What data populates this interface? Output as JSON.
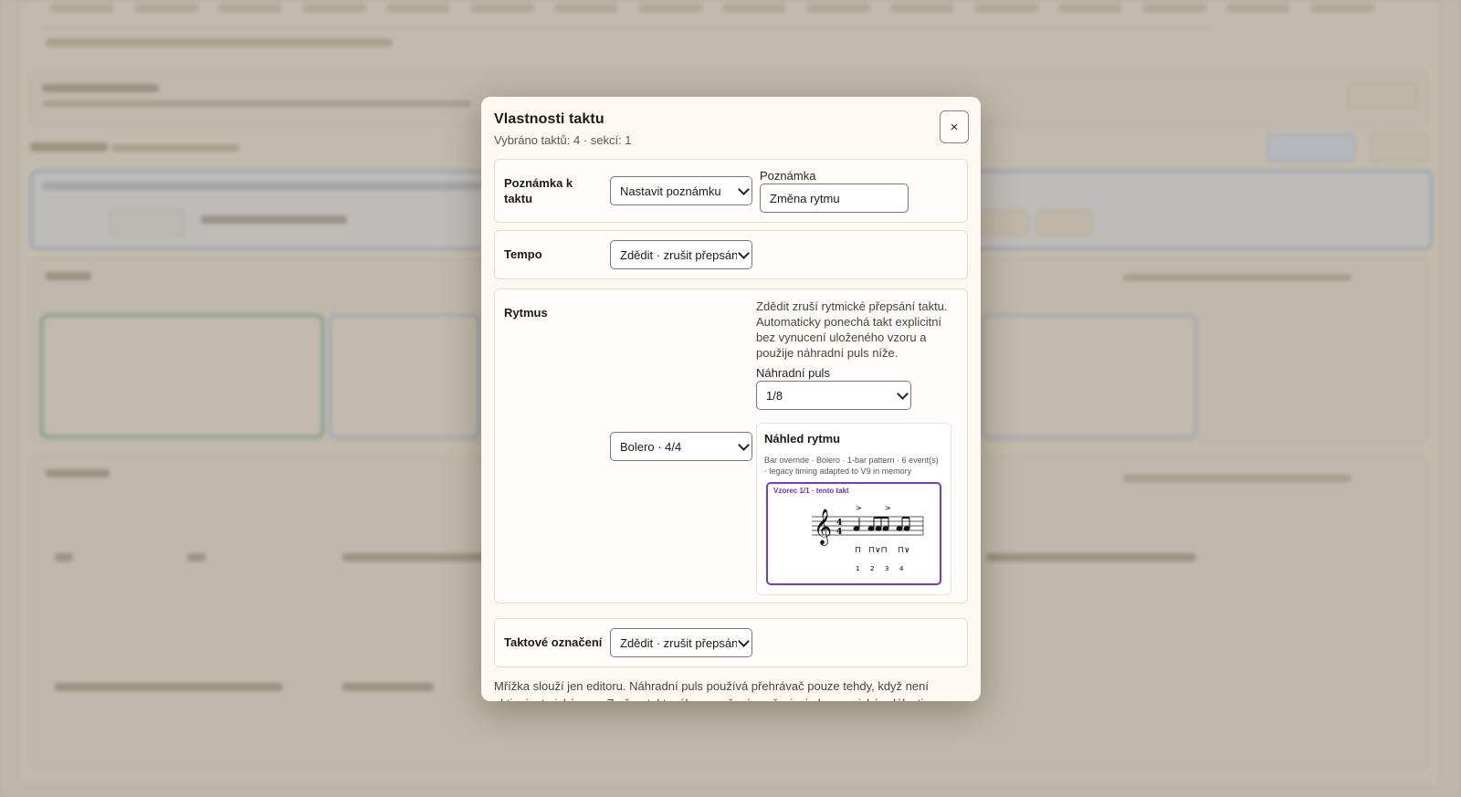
{
  "modal": {
    "title": "Vlastnosti taktu",
    "subtitle": "Vybráno taktů: 4 · sekcí: 1",
    "close_label": "×"
  },
  "note_section": {
    "label": "Poznámka k taktu",
    "select_value": "Nastavit poznámku",
    "field_label": "Poznámka",
    "field_value": "Změna rytmu"
  },
  "tempo_section": {
    "label": "Tempo",
    "select_value": "Zdědit · zrušit přepsání"
  },
  "rhythm_section": {
    "label": "Rytmus",
    "select_value": "Bolero · 4/4",
    "help_text": "Zdědit zruší rytmické přepsání taktu. Automaticky ponechá takt explicitní bez vynucení uloženého vzoru a použije náhradní puls níže.",
    "fallback_label": "Náhradní puls",
    "fallback_value": "1/8",
    "preview": {
      "title": "Náhled rytmu",
      "meta": "Bar override · Bolero · 1-bar pattern · 6 event(s) · legacy timing adapted to V9 in memory",
      "pattern_caption": "Vzorec 1/1 · tento takt",
      "time_signature_top": "4",
      "time_signature_bottom": "4",
      "accents": [
        ">",
        ">"
      ],
      "strokes": [
        "⊓",
        "⊓∨⊓",
        "⊓∨"
      ],
      "beats": [
        "1",
        "2",
        "3",
        "4"
      ]
    }
  },
  "timesig_section": {
    "label": "Taktové označení",
    "select_value": "Zdědit · zrušit přepsání"
  },
  "footer": {
    "text": "Mřížka slouží jen editoru. Náhradní puls používá přehrávač pouze tehdy, když není aktivní rytmický vzor. Změna taktového označení nepřepisuje harmonické události."
  },
  "colors": {
    "accent_purple": "#7a37c8",
    "modal_bg": "#fdf9f2",
    "section_border": "#e7dcc8"
  }
}
